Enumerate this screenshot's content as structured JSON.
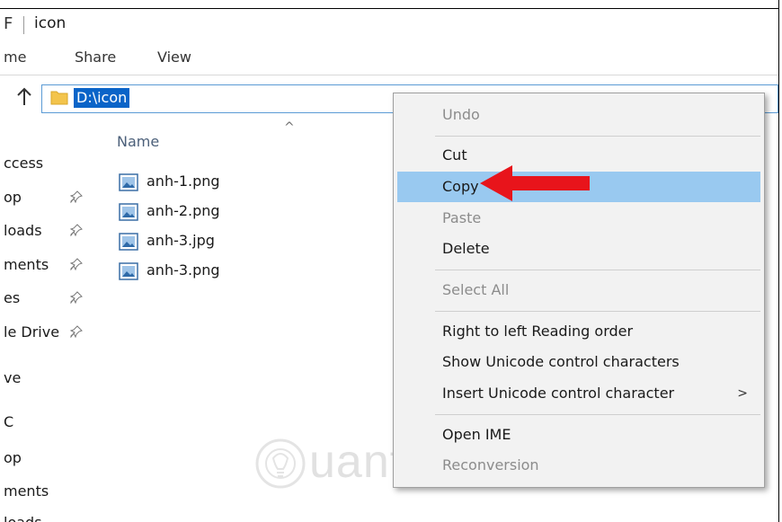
{
  "window": {
    "title_glyph": "F",
    "title": "icon"
  },
  "ribbon": {
    "tabs": [
      {
        "label": "me"
      },
      {
        "label": "Share"
      },
      {
        "label": "View"
      }
    ]
  },
  "address": {
    "path": "D:\\icon"
  },
  "file_list": {
    "column_name": "Name",
    "files": [
      {
        "name": "anh-1.png"
      },
      {
        "name": "anh-2.png"
      },
      {
        "name": "anh-3.jpg"
      },
      {
        "name": "anh-3.png"
      }
    ]
  },
  "nav_pane": {
    "items": [
      {
        "label": "ccess",
        "pinned": false
      },
      {
        "label": "op",
        "pinned": true
      },
      {
        "label": "loads",
        "pinned": true
      },
      {
        "label": "ments",
        "pinned": true
      },
      {
        "label": "es",
        "pinned": true
      },
      {
        "label": "le Drive",
        "pinned": true
      },
      {
        "label": "ve",
        "pinned": false
      },
      {
        "label": "C",
        "pinned": false
      },
      {
        "label": "op",
        "pinned": false
      },
      {
        "label": "ments",
        "pinned": false
      },
      {
        "label": "loads",
        "pinned": false
      }
    ]
  },
  "context_menu": {
    "items": [
      {
        "label": "Undo",
        "disabled": true
      },
      {
        "label": "Cut",
        "disabled": false
      },
      {
        "label": "Copy",
        "disabled": false,
        "highlighted": true
      },
      {
        "label": "Paste",
        "disabled": true
      },
      {
        "label": "Delete",
        "disabled": false
      },
      {
        "label": "Select All",
        "disabled": true
      },
      {
        "label": "Right to left Reading order",
        "disabled": false
      },
      {
        "label": "Show Unicode control characters",
        "disabled": false
      },
      {
        "label": "Insert Unicode control character",
        "disabled": false,
        "submenu_arrow": ">"
      },
      {
        "label": "Open IME",
        "disabled": false
      },
      {
        "label": "Reconversion",
        "disabled": true
      }
    ]
  },
  "annotation": {
    "arrow_color": "#e8141b"
  },
  "watermark": {
    "text": "uantrimang"
  },
  "colors": {
    "accent": "#0a64c8",
    "menu_highlight": "#99c9f0",
    "folder": "#f3c44c"
  }
}
